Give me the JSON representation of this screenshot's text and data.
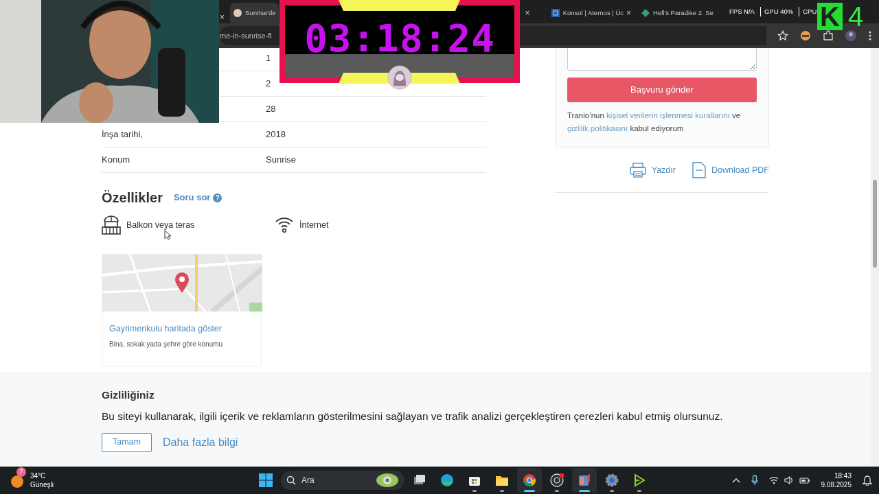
{
  "browser": {
    "strip_close": "×",
    "tabs": [
      {
        "title": "Sunrise'de",
        "selected": true
      },
      {
        "close": "×",
        "selected": false
      },
      {
        "title": "Konsol | Aternos | Üc",
        "close": "×",
        "selected": false
      },
      {
        "title": "Hell's Paradise 2. Se",
        "selected": false
      }
    ],
    "address": "me-in-sunrise-fl"
  },
  "overlays": {
    "timer": "03:18:24",
    "stats": [
      {
        "label": "FPS",
        "value": "N/A"
      },
      {
        "label": "GPU",
        "value": "40%"
      },
      {
        "label": "CPU"
      }
    ],
    "logo": {
      "letter": "K",
      "number": "4"
    }
  },
  "details": [
    {
      "value": "1"
    },
    {
      "value": "2"
    },
    {
      "value": "28"
    },
    {
      "label": "İnşa tarihi,",
      "value": "2018"
    },
    {
      "label": "Konum",
      "value": "Sunrise"
    }
  ],
  "features": {
    "title": "Özellikler",
    "ask": "Soru sor",
    "help": "?",
    "items": [
      {
        "kind": "balcony",
        "label": "Balkon veya teras"
      },
      {
        "kind": "wifi",
        "label": "İnternet"
      }
    ],
    "map_card": {
      "title": "Gayrimenkulu haritada göster",
      "subtitle": "Bina, sokak yada şehre göre konumu"
    }
  },
  "application_form": {
    "submit": "Başvuru gönder",
    "consent": [
      {
        "kind": "text",
        "text": "Tranio’nun "
      },
      {
        "kind": "link",
        "text": "kişisel verilerin işlenmesi kurallarını"
      },
      {
        "kind": "text",
        "text": " ve "
      },
      {
        "kind": "link",
        "text": "gizlilik politikasını"
      },
      {
        "kind": "text",
        "text": " kabul ediyorum"
      }
    ]
  },
  "actions": [
    {
      "kind": "print",
      "label": "Yazdır"
    },
    {
      "kind": "pdf",
      "label": "Download PDF"
    }
  ],
  "cookie_banner": {
    "title": "Gizliliğiniz",
    "text": "Bu siteyi kullanarak, ilgili içerik ve reklamların gösterilmesini sağlayan ve trafik analizi gerçekleştiren çerezleri kabul etmiş olursunuz.",
    "accept": "Tamam",
    "more": "Daha fazla bilgi"
  },
  "taskbar": {
    "weather": {
      "badge": "7",
      "temperature": "34°C",
      "condition": "Güneşli"
    },
    "search": {
      "placeholder": "Ara"
    },
    "apps": [
      {
        "kind": "taskview",
        "running": false,
        "selected": false
      },
      {
        "kind": "edge",
        "running": false,
        "selected": false
      },
      {
        "kind": "store",
        "running": true,
        "selected": false
      },
      {
        "kind": "files",
        "running": true,
        "selected": false
      },
      {
        "kind": "chrome",
        "running": true,
        "selected": true
      },
      {
        "kind": "obs",
        "running": true,
        "selected": false
      },
      {
        "kind": "monitor",
        "running": true,
        "selected": true
      },
      {
        "kind": "settings",
        "running": true,
        "selected": false
      },
      {
        "kind": "player",
        "running": true,
        "selected": false
      }
    ],
    "time": "18:43",
    "date": "9.08.2025"
  }
}
